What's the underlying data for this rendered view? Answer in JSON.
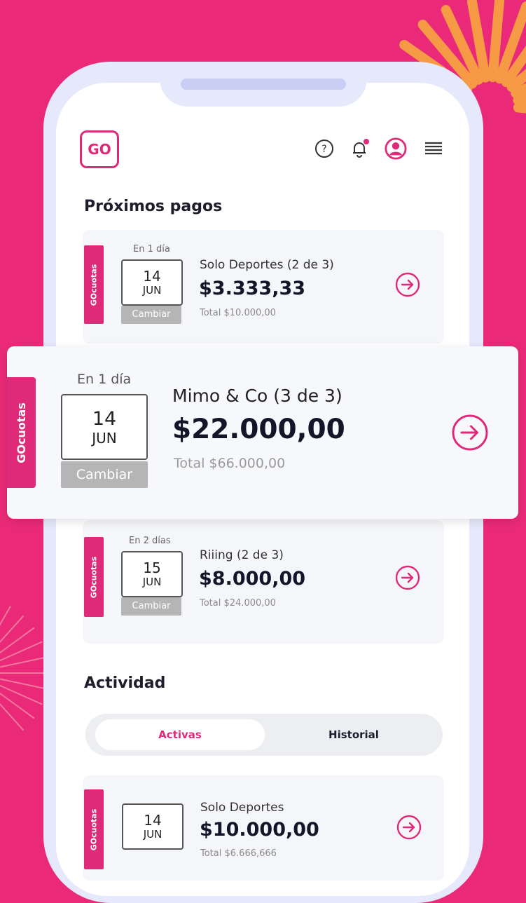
{
  "colors": {
    "background": "#ea2a78",
    "accent": "#df2a7a",
    "burst": "#f79a45"
  },
  "header": {
    "logo_text": "GO",
    "icons": [
      "help-icon",
      "bell-icon",
      "user-icon",
      "menu-icon"
    ]
  },
  "proximos": {
    "title": "Próximos pagos",
    "payments": [
      {
        "tag": "GOcuotas",
        "due": "En 1 día",
        "day": "14",
        "month": "JUN",
        "change_label": "Cambiar",
        "merchant": "Solo Deportes (2 de 3)",
        "amount": "$3.333,33",
        "total": "Total $10.000,00"
      },
      {
        "tag": "GOcuotas",
        "due": "En 1 día",
        "day": "14",
        "month": "JUN",
        "change_label": "Cambiar",
        "merchant": "Mimo & Co (3 de 3)",
        "amount": "$22.000,00",
        "total": "Total $66.000,00"
      },
      {
        "tag": "GOcuotas",
        "due": "En 2 días",
        "day": "15",
        "month": "JUN",
        "change_label": "Cambiar",
        "merchant": "Riiing (2 de 3)",
        "amount": "$8.000,00",
        "total": "Total $24.000,00"
      }
    ]
  },
  "actividad": {
    "title": "Actividad",
    "tabs": [
      "Activas",
      "Historial"
    ],
    "items": [
      {
        "tag": "GOcuotas",
        "day": "14",
        "month": "JUN",
        "merchant": "Solo Deportes",
        "amount": "$10.000,00",
        "total": "Total $6.666,666"
      }
    ]
  }
}
